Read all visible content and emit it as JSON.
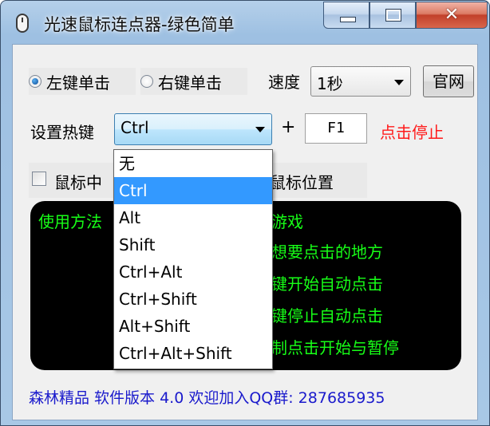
{
  "window": {
    "title": "光速鼠标连点器-绿色简单",
    "close_glyph": "✕"
  },
  "click_mode": {
    "left_label": "左键单击",
    "right_label": "右键单击",
    "selected": "left"
  },
  "speed": {
    "label": "速度",
    "value": "1秒"
  },
  "site_button_label": "官网",
  "hotkey": {
    "label": "设置热键",
    "modifier_value": "Ctrl",
    "plus": "+",
    "key_value": "F1",
    "status": "点击停止",
    "options": [
      "无",
      "Ctrl",
      "Alt",
      "Shift",
      "Ctrl+Alt",
      "Ctrl+Shift",
      "Alt+Shift",
      "Ctrl+Alt+Shift"
    ],
    "highlighted_index": 1
  },
  "checkbox": {
    "label_visible": "鼠标中",
    "label_suffix_visible": "鼠标位置",
    "checked": false
  },
  "instructions": {
    "lines": [
      "使用方法",
      "游戏",
      "想要点击的地方",
      "键开始自动点击",
      "键停止自动点击",
      "制点击开始与暂停"
    ]
  },
  "footer": "森林精品 软件版本 4.0 欢迎加入QQ群: 287685935",
  "colors": {
    "accent_highlight": "#3399ff",
    "instruction_text": "#17ff17",
    "status_text": "#ff1a1a",
    "footer_text": "#1a1acc"
  }
}
